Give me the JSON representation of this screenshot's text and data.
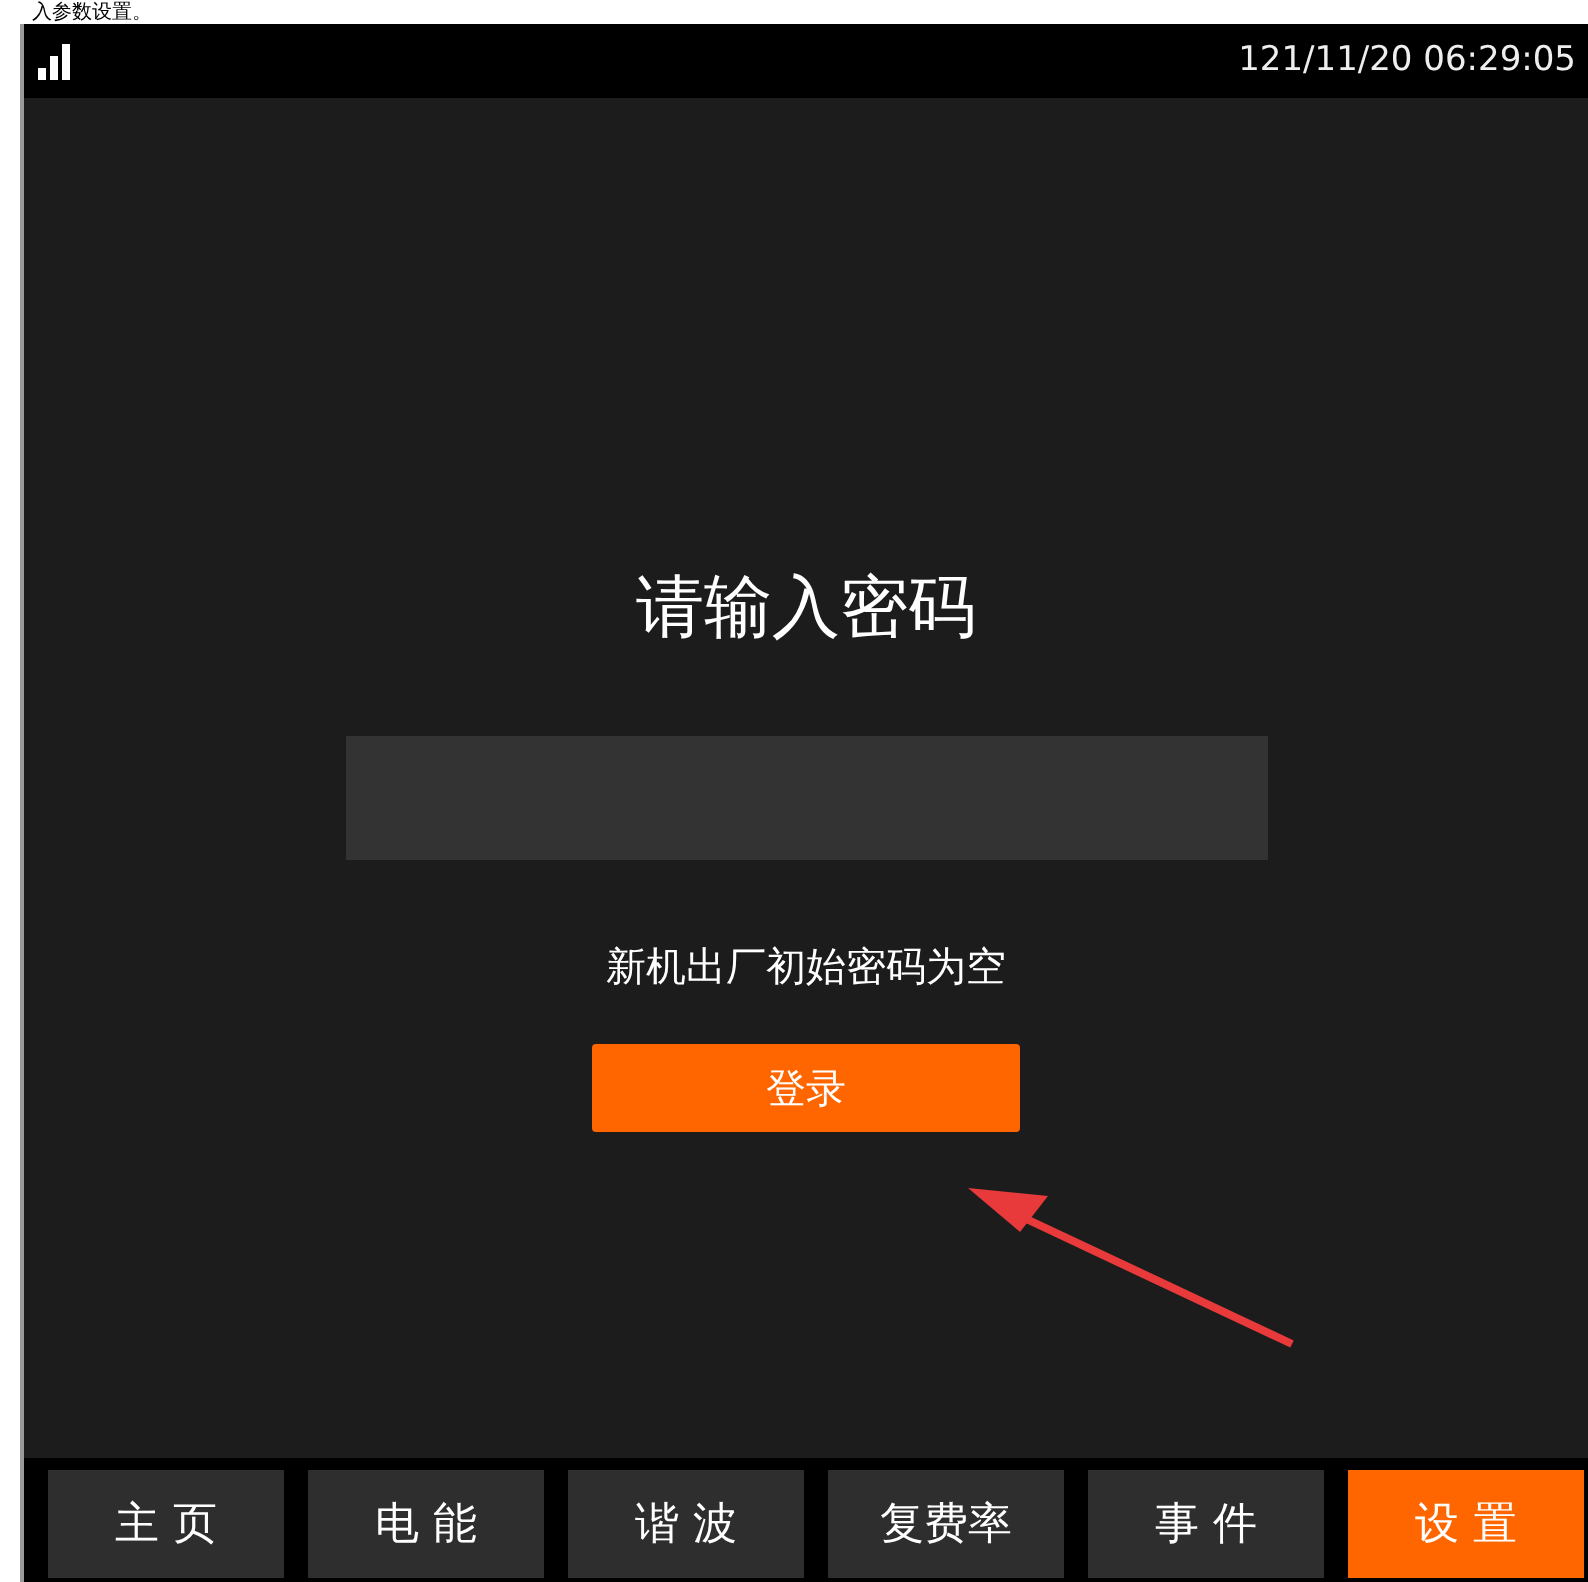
{
  "caption": "入参数设置。",
  "status_bar": {
    "time": "121/11/20 06:29:05"
  },
  "login": {
    "title": "请输入密码",
    "hint": "新机出厂初始密码为空",
    "button": "登录"
  },
  "tabs": [
    {
      "label": "主 页",
      "selected": false
    },
    {
      "label": "电 能",
      "selected": false
    },
    {
      "label": "谐 波",
      "selected": false
    },
    {
      "label": "复费率",
      "selected": false
    },
    {
      "label": "事 件",
      "selected": false
    },
    {
      "label": "设 置",
      "selected": true
    }
  ]
}
